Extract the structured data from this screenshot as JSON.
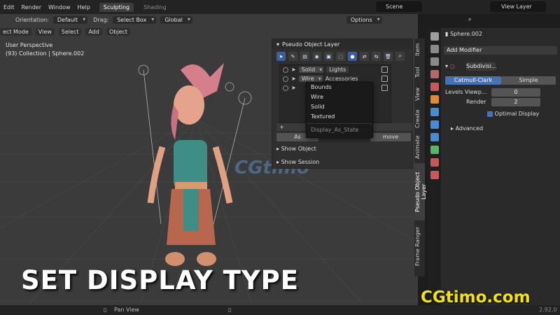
{
  "topbar": {
    "menus": [
      "Edit",
      "Render",
      "Window",
      "Help"
    ],
    "workspaces": [
      {
        "label": "Sculpting",
        "active": true
      },
      {
        "label": "Shading",
        "active": false
      }
    ],
    "scene": "Scene",
    "view_layer": "View Layer"
  },
  "viewport_header": {
    "orientation_label": "Orientation:",
    "orientation_value": "Default",
    "drag_label": "Drag:",
    "drag_value": "Select Box",
    "transform_value": "Global",
    "options_label": "Options"
  },
  "viewport_header2": {
    "mode": "ect Mode",
    "items": [
      "View",
      "Select",
      "Add",
      "Object"
    ]
  },
  "viewport_overlay": {
    "perspective": "User Perspective",
    "collection": "(93) Collection | Sphere.002"
  },
  "pseudo_panel": {
    "title": "Pseudo Object Layer",
    "rows": [
      {
        "display": "Solid",
        "name": "Lights"
      },
      {
        "display": "Wire",
        "name": "Accessories"
      },
      {
        "display": "",
        "name": ""
      }
    ],
    "add_label": "+",
    "assign_label": "As",
    "remove_label": "move",
    "show_object": "Show Object",
    "show_session": "Show Session"
  },
  "display_menu": {
    "items": [
      "Bounds",
      "Wire",
      "Solid",
      "Textured"
    ],
    "hint": "Display_As_State"
  },
  "sidebar_tabs": [
    {
      "label": "Item",
      "active": false
    },
    {
      "label": "Tool",
      "active": false
    },
    {
      "label": "View",
      "active": false
    },
    {
      "label": "Create",
      "active": false
    },
    {
      "label": "Animate",
      "active": false
    },
    {
      "label": "Pseudo Object Layer",
      "active": true
    },
    {
      "label": "Frame Ranger",
      "active": false
    }
  ],
  "properties": {
    "search_placeholder": "",
    "object_name": "Sphere.002",
    "add_modifier": "Add Modifier",
    "modifier_name": "Subdivisi...",
    "catmull": "Catmull-Clark",
    "simple": "Simple",
    "levels_label": "Levels Viewp...",
    "levels_value": "0",
    "render_label": "Render",
    "render_value": "2",
    "optimal_display": "Optimal Display",
    "advanced": "Advanced"
  },
  "status": {
    "pan_view": "Pan View",
    "version": "2.92.0"
  },
  "caption": "SET DISPLAY TYPE",
  "watermark": "CGtimo.com",
  "watermark_center": "CGtimo",
  "colors": {
    "accent": "#4772b3",
    "watermark": "#f4e400"
  }
}
